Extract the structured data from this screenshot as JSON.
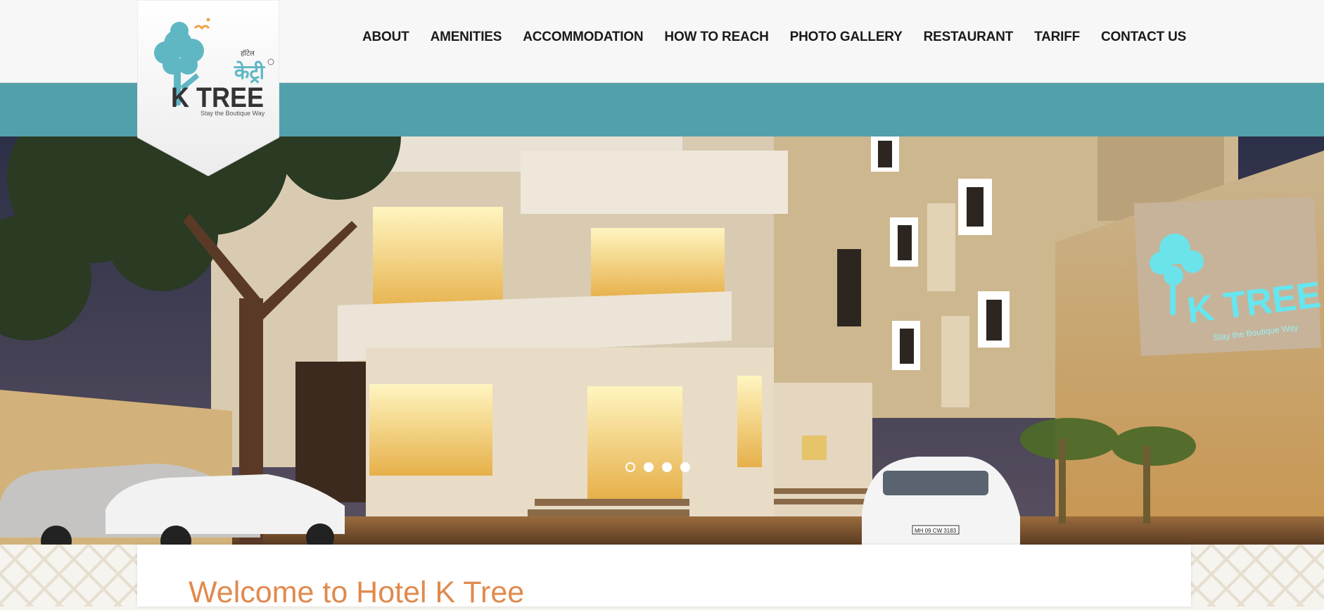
{
  "header": {
    "nav": [
      {
        "id": "about",
        "label": "ABOUT"
      },
      {
        "id": "amenities",
        "label": "AMENITIES"
      },
      {
        "id": "accommodation",
        "label": "ACCOMMODATION"
      },
      {
        "id": "how-to-reach",
        "label": "HOW TO REACH"
      },
      {
        "id": "photo-gallery",
        "label": "PHOTO GALLERY"
      },
      {
        "id": "restaurant",
        "label": "RESTAURANT"
      },
      {
        "id": "tariff",
        "label": "TARIFF"
      },
      {
        "id": "contact-us",
        "label": "CONTACT US"
      }
    ],
    "band_color": "#52a0ab"
  },
  "logo": {
    "devanagari_small": "हॉटेल",
    "devanagari": "केट्री",
    "brand": "K TREE",
    "tagline": "Stay the Boutique Way",
    "brand_color": "#5fb7c4"
  },
  "hero": {
    "slides_count": 4,
    "active_slide": 1,
    "sign_brand": "K TREE",
    "sign_tagline": "Stay   the Boutique Way",
    "car_plate": "MH 09 CW 3183"
  },
  "content": {
    "welcome_title": "Welcome to Hotel K Tree",
    "title_color": "#e08a4e"
  }
}
